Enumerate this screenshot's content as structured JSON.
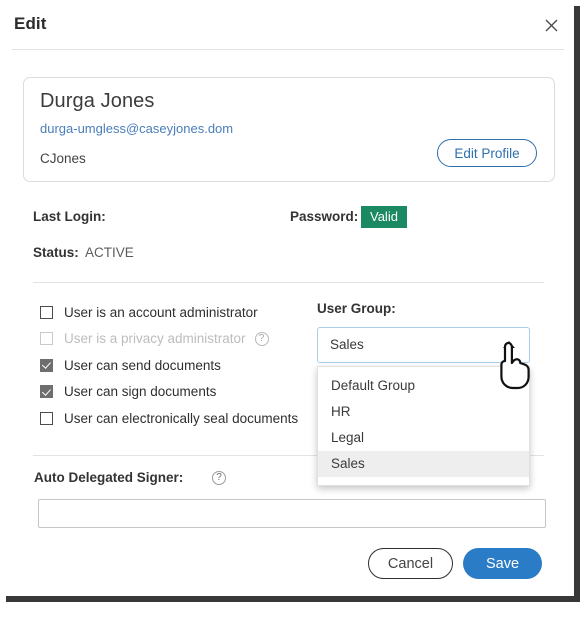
{
  "dialog": {
    "title": "Edit",
    "close_label": "×"
  },
  "profile": {
    "name": "Durga Jones",
    "email": "durga-umgless@caseyjones.dom",
    "username": "CJones",
    "edit_profile_label": "Edit Profile"
  },
  "info": {
    "last_login_label": "Last Login:",
    "last_login_value": "",
    "password_label": "Password:",
    "password_status": "Valid",
    "password_status_color": "#1b8a62",
    "status_label": "Status:",
    "status_value": "ACTIVE"
  },
  "permissions": [
    {
      "label": "User is an account administrator",
      "checked": false,
      "disabled": false,
      "help": false
    },
    {
      "label": "User is a privacy administrator",
      "checked": false,
      "disabled": true,
      "help": true
    },
    {
      "label": "User can send documents",
      "checked": true,
      "disabled": false,
      "help": false
    },
    {
      "label": "User can sign documents",
      "checked": true,
      "disabled": false,
      "help": false
    },
    {
      "label": "User can electronically seal documents",
      "checked": false,
      "disabled": false,
      "help": false
    }
  ],
  "user_group": {
    "label": "User Group:",
    "selected": "Sales",
    "expanded": true,
    "options": [
      "Default Group",
      "HR",
      "Legal",
      "Sales"
    ]
  },
  "auto_delegated_signer": {
    "label": "Auto Delegated Signer:",
    "value": "",
    "placeholder": ""
  },
  "footer": {
    "cancel_label": "Cancel",
    "save_label": "Save",
    "save_color": "#2b7cc6"
  },
  "icons": {
    "help": "?",
    "cursor": "pointing-hand-cursor"
  }
}
